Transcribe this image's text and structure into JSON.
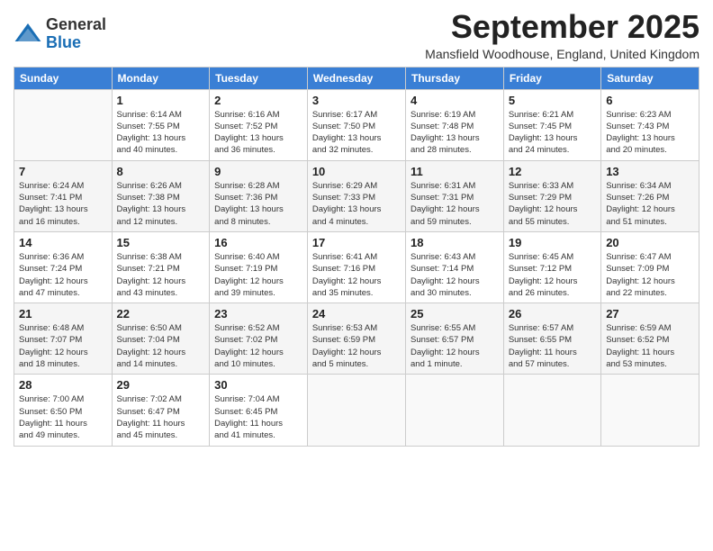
{
  "header": {
    "logo_general": "General",
    "logo_blue": "Blue",
    "month_title": "September 2025",
    "subtitle": "Mansfield Woodhouse, England, United Kingdom"
  },
  "weekdays": [
    "Sunday",
    "Monday",
    "Tuesday",
    "Wednesday",
    "Thursday",
    "Friday",
    "Saturday"
  ],
  "weeks": [
    [
      {
        "day": "",
        "info": ""
      },
      {
        "day": "1",
        "info": "Sunrise: 6:14 AM\nSunset: 7:55 PM\nDaylight: 13 hours\nand 40 minutes."
      },
      {
        "day": "2",
        "info": "Sunrise: 6:16 AM\nSunset: 7:52 PM\nDaylight: 13 hours\nand 36 minutes."
      },
      {
        "day": "3",
        "info": "Sunrise: 6:17 AM\nSunset: 7:50 PM\nDaylight: 13 hours\nand 32 minutes."
      },
      {
        "day": "4",
        "info": "Sunrise: 6:19 AM\nSunset: 7:48 PM\nDaylight: 13 hours\nand 28 minutes."
      },
      {
        "day": "5",
        "info": "Sunrise: 6:21 AM\nSunset: 7:45 PM\nDaylight: 13 hours\nand 24 minutes."
      },
      {
        "day": "6",
        "info": "Sunrise: 6:23 AM\nSunset: 7:43 PM\nDaylight: 13 hours\nand 20 minutes."
      }
    ],
    [
      {
        "day": "7",
        "info": "Sunrise: 6:24 AM\nSunset: 7:41 PM\nDaylight: 13 hours\nand 16 minutes."
      },
      {
        "day": "8",
        "info": "Sunrise: 6:26 AM\nSunset: 7:38 PM\nDaylight: 13 hours\nand 12 minutes."
      },
      {
        "day": "9",
        "info": "Sunrise: 6:28 AM\nSunset: 7:36 PM\nDaylight: 13 hours\nand 8 minutes."
      },
      {
        "day": "10",
        "info": "Sunrise: 6:29 AM\nSunset: 7:33 PM\nDaylight: 13 hours\nand 4 minutes."
      },
      {
        "day": "11",
        "info": "Sunrise: 6:31 AM\nSunset: 7:31 PM\nDaylight: 12 hours\nand 59 minutes."
      },
      {
        "day": "12",
        "info": "Sunrise: 6:33 AM\nSunset: 7:29 PM\nDaylight: 12 hours\nand 55 minutes."
      },
      {
        "day": "13",
        "info": "Sunrise: 6:34 AM\nSunset: 7:26 PM\nDaylight: 12 hours\nand 51 minutes."
      }
    ],
    [
      {
        "day": "14",
        "info": "Sunrise: 6:36 AM\nSunset: 7:24 PM\nDaylight: 12 hours\nand 47 minutes."
      },
      {
        "day": "15",
        "info": "Sunrise: 6:38 AM\nSunset: 7:21 PM\nDaylight: 12 hours\nand 43 minutes."
      },
      {
        "day": "16",
        "info": "Sunrise: 6:40 AM\nSunset: 7:19 PM\nDaylight: 12 hours\nand 39 minutes."
      },
      {
        "day": "17",
        "info": "Sunrise: 6:41 AM\nSunset: 7:16 PM\nDaylight: 12 hours\nand 35 minutes."
      },
      {
        "day": "18",
        "info": "Sunrise: 6:43 AM\nSunset: 7:14 PM\nDaylight: 12 hours\nand 30 minutes."
      },
      {
        "day": "19",
        "info": "Sunrise: 6:45 AM\nSunset: 7:12 PM\nDaylight: 12 hours\nand 26 minutes."
      },
      {
        "day": "20",
        "info": "Sunrise: 6:47 AM\nSunset: 7:09 PM\nDaylight: 12 hours\nand 22 minutes."
      }
    ],
    [
      {
        "day": "21",
        "info": "Sunrise: 6:48 AM\nSunset: 7:07 PM\nDaylight: 12 hours\nand 18 minutes."
      },
      {
        "day": "22",
        "info": "Sunrise: 6:50 AM\nSunset: 7:04 PM\nDaylight: 12 hours\nand 14 minutes."
      },
      {
        "day": "23",
        "info": "Sunrise: 6:52 AM\nSunset: 7:02 PM\nDaylight: 12 hours\nand 10 minutes."
      },
      {
        "day": "24",
        "info": "Sunrise: 6:53 AM\nSunset: 6:59 PM\nDaylight: 12 hours\nand 5 minutes."
      },
      {
        "day": "25",
        "info": "Sunrise: 6:55 AM\nSunset: 6:57 PM\nDaylight: 12 hours\nand 1 minute."
      },
      {
        "day": "26",
        "info": "Sunrise: 6:57 AM\nSunset: 6:55 PM\nDaylight: 11 hours\nand 57 minutes."
      },
      {
        "day": "27",
        "info": "Sunrise: 6:59 AM\nSunset: 6:52 PM\nDaylight: 11 hours\nand 53 minutes."
      }
    ],
    [
      {
        "day": "28",
        "info": "Sunrise: 7:00 AM\nSunset: 6:50 PM\nDaylight: 11 hours\nand 49 minutes."
      },
      {
        "day": "29",
        "info": "Sunrise: 7:02 AM\nSunset: 6:47 PM\nDaylight: 11 hours\nand 45 minutes."
      },
      {
        "day": "30",
        "info": "Sunrise: 7:04 AM\nSunset: 6:45 PM\nDaylight: 11 hours\nand 41 minutes."
      },
      {
        "day": "",
        "info": ""
      },
      {
        "day": "",
        "info": ""
      },
      {
        "day": "",
        "info": ""
      },
      {
        "day": "",
        "info": ""
      }
    ]
  ]
}
